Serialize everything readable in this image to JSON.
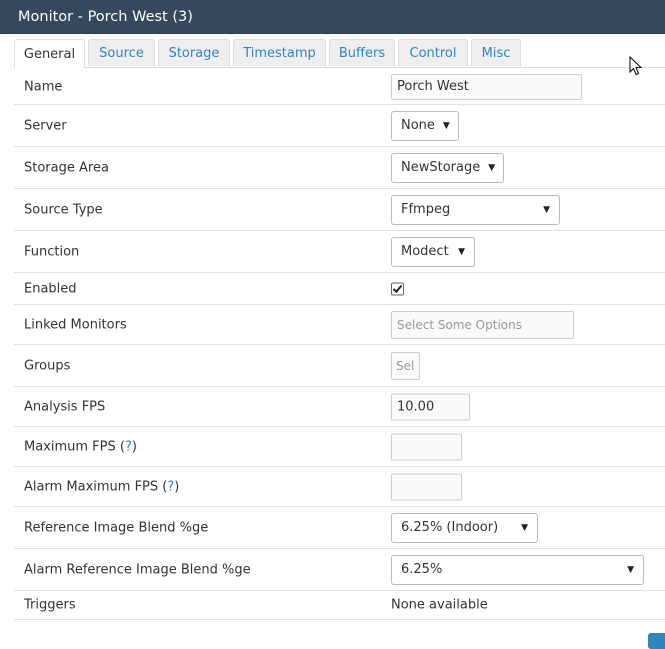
{
  "window": {
    "title": "Monitor - Porch West (3)"
  },
  "tabs": [
    {
      "label": "General",
      "active": true
    },
    {
      "label": "Source"
    },
    {
      "label": "Storage"
    },
    {
      "label": "Timestamp"
    },
    {
      "label": "Buffers"
    },
    {
      "label": "Control"
    },
    {
      "label": "Misc"
    }
  ],
  "fields": {
    "name": {
      "label": "Name",
      "value": "Porch West"
    },
    "server": {
      "label": "Server",
      "value": "None"
    },
    "storage_area": {
      "label": "Storage Area",
      "value": "NewStorage"
    },
    "source_type": {
      "label": "Source Type",
      "value": "Ffmpeg"
    },
    "function": {
      "label": "Function",
      "value": "Modect"
    },
    "enabled": {
      "label": "Enabled",
      "checked": true
    },
    "linked_monitors": {
      "label": "Linked Monitors",
      "placeholder": "Select Some Options"
    },
    "groups": {
      "label": "Groups",
      "placeholder": "Sel"
    },
    "analysis_fps": {
      "label": "Analysis FPS",
      "value": "10.00"
    },
    "maximum_fps": {
      "label": "Maximum FPS",
      "help": "?",
      "value": ""
    },
    "alarm_maximum_fps": {
      "label": "Alarm Maximum FPS",
      "help": "?",
      "value": ""
    },
    "ref_blend": {
      "label": "Reference Image Blend %ge",
      "value": "6.25% (Indoor)"
    },
    "alarm_ref_blend": {
      "label": "Alarm Reference Image Blend %ge",
      "value": "6.25%"
    },
    "triggers": {
      "label": "Triggers",
      "value": "None available"
    }
  },
  "colors": {
    "titlebar": "#34495e",
    "link": "#2e86c1",
    "border": "#dddddd"
  }
}
